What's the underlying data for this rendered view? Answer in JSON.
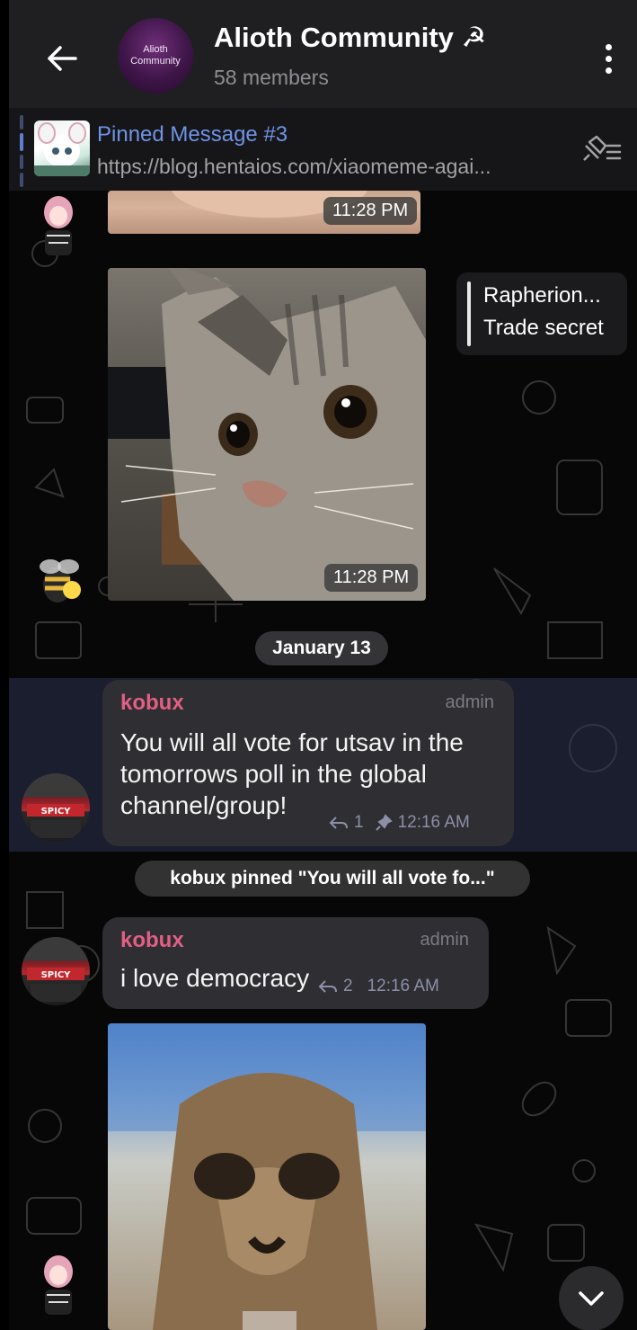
{
  "header": {
    "title": "Alioth Community ☭",
    "member_count": "58 members",
    "avatar_line1": "Alioth",
    "avatar_line2": "Community"
  },
  "pinned": {
    "title": "Pinned Message #3",
    "text": "https://blog.hentaios.com/xiaomeme-agai..."
  },
  "messages": {
    "photo1_time": "11:28 PM",
    "photo2_time": "11:28 PM",
    "reply_quote_name": "Rapherion...",
    "reply_quote_text": "Trade secret",
    "date_separator": "January 13",
    "msg1": {
      "sender": "kobux",
      "role": "admin",
      "line1": "You will all vote for utsav in the",
      "line2": "tomorrows poll in the global",
      "line3": "channel/group!",
      "replies": "1",
      "time": "12:16 AM"
    },
    "service_pin": "kobux pinned \"You will all vote fo...\"",
    "msg2": {
      "sender": "kobux",
      "role": "admin",
      "text": "i love democracy",
      "replies": "2",
      "time": "12:16 AM"
    }
  },
  "colors": {
    "header_bg": "#1f1f21",
    "pinned_title": "#6f93e6",
    "sender_name": "#e35f84",
    "bubble_bg": "#2e2e33"
  },
  "icons": {
    "back": "arrow-left-icon",
    "menu": "more-vertical-icon",
    "pin_list": "pin-list-icon",
    "reply": "reply-icon",
    "pin": "pin-icon",
    "scroll": "chevron-down-icon"
  }
}
